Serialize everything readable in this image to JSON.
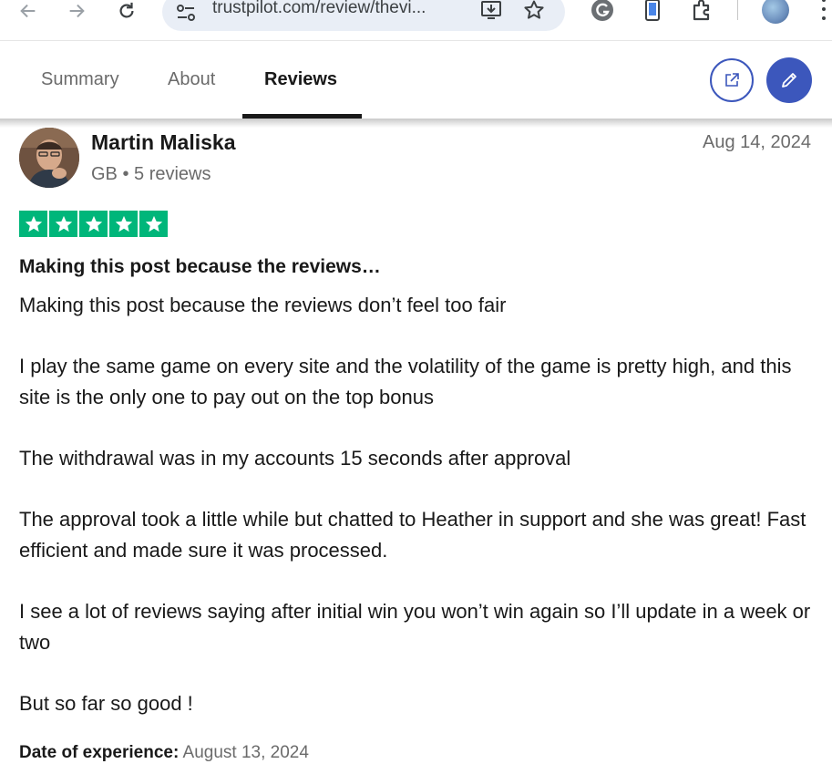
{
  "browser": {
    "url": "trustpilot.com/review/thevi...",
    "colors": {
      "omnibox_bg": "#e9eef6"
    },
    "icons": [
      "back-arrow-icon",
      "forward-arrow-icon",
      "reload-icon",
      "site-settings-icon",
      "install-app-icon",
      "bookmark-star-icon",
      "grammarly-icon",
      "phone-link-icon",
      "extensions-icon",
      "profile-avatar",
      "menu-kebab-icon"
    ]
  },
  "tabs": {
    "items": [
      {
        "label": "Summary"
      },
      {
        "label": "About"
      },
      {
        "label": "Reviews"
      }
    ],
    "active": "Reviews",
    "actions": [
      "share-icon",
      "pencil-icon"
    ],
    "colors": {
      "accent": "#3c57bc"
    }
  },
  "review": {
    "reviewer_name": "Martin Maliska",
    "reviewer_meta": "GB • 5 reviews",
    "date": "Aug 14, 2024",
    "rating": 5,
    "star_color": "#00b67a",
    "title": "Making this post because the reviews…",
    "body": [
      "Making this post because the reviews don’t feel too fair",
      "I play the same game on every site and the volatility of the game is pretty high, and this site is the only one to pay out on the top bonus",
      "The withdrawal was in my accounts 15 seconds after approval",
      "The approval took a little while but chatted to Heather in support and she was great! Fast efficient and made sure it was processed.",
      "I see a lot of reviews saying after initial win you won’t win again so I’ll update in a week or two",
      "But so far so good !"
    ],
    "experience_label": "Date of experience:",
    "experience_date": "August 13, 2024"
  }
}
